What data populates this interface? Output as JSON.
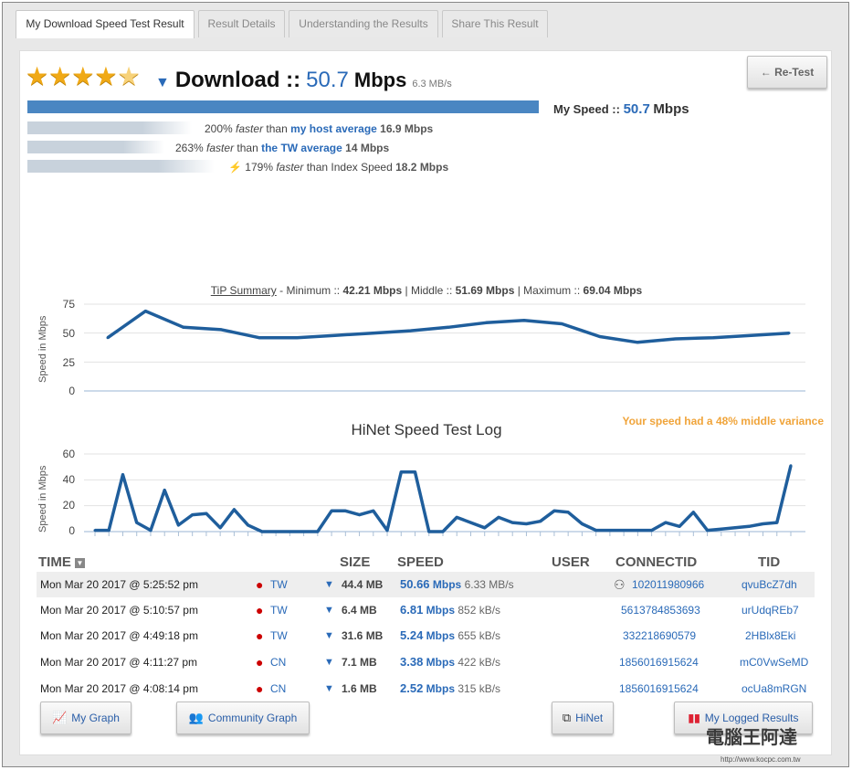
{
  "tabs": [
    {
      "label": "My Download Speed Test Result"
    },
    {
      "label": "Result Details"
    },
    {
      "label": "Understanding the Results"
    },
    {
      "label": "Share This Result"
    }
  ],
  "retest_label": "← Re-Test",
  "rating": {
    "stars": 4.5,
    "max": 5
  },
  "download": {
    "label": "Download ::",
    "value": "50.7",
    "unit": "Mbps",
    "mbs": "6.3 MB/s"
  },
  "my_speed": {
    "label": "My Speed ::",
    "value": "50.7",
    "unit": "Mbps"
  },
  "comparisons": [
    {
      "pct": "200%",
      "faster": "faster",
      "than": "than",
      "ref": "my host average",
      "value": "16.9 Mbps",
      "fill": 0.33
    },
    {
      "pct": "263%",
      "faster": "faster",
      "than": "than",
      "ref": "the TW average",
      "value": "14 Mbps",
      "fill": 0.28
    },
    {
      "pct": "179%",
      "faster": "faster",
      "than": "than Index Speed",
      "ref": "",
      "value": "18.2 Mbps",
      "fill": 0.36
    }
  ],
  "summary": {
    "link": "TiP Summary",
    "min_label": "- Minimum ::",
    "min": "42.21 Mbps",
    "mid_label": "| Middle ::",
    "mid": "51.69 Mbps",
    "max_label": "| Maximum ::",
    "max": "69.04 Mbps"
  },
  "variance_text": "Your speed had a 48% middle variance",
  "tip_chart": {
    "ylabel": "Speed in Mbps",
    "yticks": [
      "75",
      "50",
      "25",
      "0"
    ],
    "ylim": [
      0,
      75
    ],
    "values": [
      46,
      69,
      55,
      53,
      46,
      46,
      48,
      50,
      52,
      55,
      59,
      61,
      58,
      47,
      42,
      45,
      46,
      48,
      50
    ]
  },
  "log_chart": {
    "title": "HiNet Speed Test Log",
    "ylabel": "Speed in Mbps",
    "yticks": [
      "60",
      "40",
      "20",
      "0"
    ],
    "ylim": [
      0,
      60
    ],
    "values": [
      1,
      1,
      44,
      7,
      1,
      32,
      5,
      13,
      14,
      3,
      17,
      5,
      0,
      0,
      0,
      0,
      0,
      16,
      16,
      13,
      16,
      1,
      46,
      46,
      0,
      0,
      11,
      7,
      3,
      11,
      7,
      6,
      8,
      16,
      15,
      6,
      1,
      1,
      1,
      1,
      1,
      7,
      4,
      15,
      1,
      2,
      3,
      4,
      6,
      7,
      51
    ]
  },
  "table": {
    "headers": {
      "time": "TIME",
      "size": "SIZE",
      "speed": "SPEED",
      "user": "USER",
      "connectid": "CONNECTID",
      "tid": "TID"
    },
    "rows": [
      {
        "time": "Mon Mar 20 2017 @ 5:25:52 pm",
        "country": "TW",
        "size": "44.4 MB",
        "speed": "50.66",
        "unit": "Mbps",
        "kbs": "6.33 MB/s",
        "connectid": "102011980966",
        "tid": "qvuBcZ7dh",
        "user": true
      },
      {
        "time": "Mon Mar 20 2017 @ 5:10:57 pm",
        "country": "TW",
        "size": "6.4 MB",
        "speed": "6.81",
        "unit": "Mbps",
        "kbs": "852 kB/s",
        "connectid": "5613784853693",
        "tid": "urUdqREb7",
        "user": false
      },
      {
        "time": "Mon Mar 20 2017 @ 4:49:18 pm",
        "country": "TW",
        "size": "31.6 MB",
        "speed": "5.24",
        "unit": "Mbps",
        "kbs": "655 kB/s",
        "connectid": "332218690579",
        "tid": "2HBlx8Eki",
        "user": false
      },
      {
        "time": "Mon Mar 20 2017 @ 4:11:27 pm",
        "country": "CN",
        "size": "7.1 MB",
        "speed": "3.38",
        "unit": "Mbps",
        "kbs": "422 kB/s",
        "connectid": "1856016915624",
        "tid": "mC0VwSeMD",
        "user": false
      },
      {
        "time": "Mon Mar 20 2017 @ 4:08:14 pm",
        "country": "CN",
        "size": "1.6 MB",
        "speed": "2.52",
        "unit": "Mbps",
        "kbs": "315 kB/s",
        "connectid": "1856016915624",
        "tid": "ocUa8mRGN",
        "user": false
      }
    ]
  },
  "buttons": {
    "my_graph": "My Graph",
    "community_graph": "Community Graph",
    "hinet": "HiNet",
    "my_logged": "My Logged Results"
  },
  "watermark": {
    "text": "電腦王阿達",
    "url": "http://www.kocpc.com.tw"
  },
  "colors": {
    "accent": "#2a6ab8",
    "line": "#1f5e9c",
    "bar": "#4a86c2",
    "variance": "#f0a43a",
    "star": "#f0a916"
  }
}
